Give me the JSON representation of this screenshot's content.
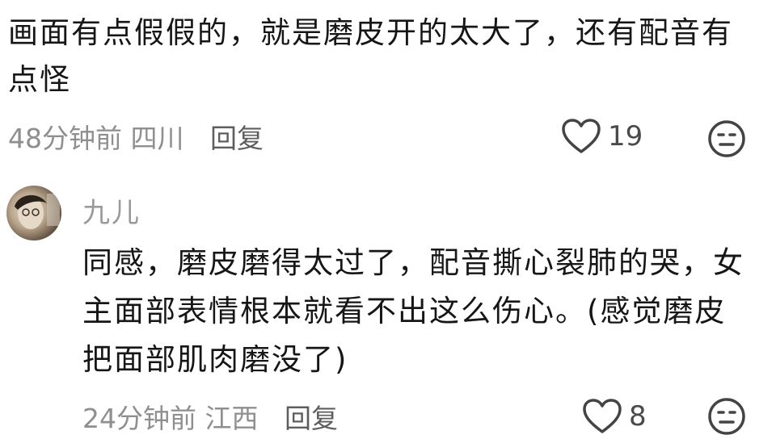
{
  "comment_1": {
    "text": "画面有点假假的，就是磨皮开的太大了，还有配音有点怪",
    "time": "48分钟前",
    "location": "四川",
    "reply_label": "回复",
    "like_count": "19"
  },
  "comment_2": {
    "username": "九儿",
    "text": "同感，磨皮磨得太过了，配音撕心裂肺的哭，女主面部表情根本就看不出这么伤心。(感觉磨皮把面部肌肉磨没了)",
    "time": "24分钟前",
    "location": "江西",
    "reply_label": "回复",
    "like_count": "8"
  },
  "icons": {
    "like": "heart-outline-icon",
    "react": "neutral-face-icon"
  }
}
